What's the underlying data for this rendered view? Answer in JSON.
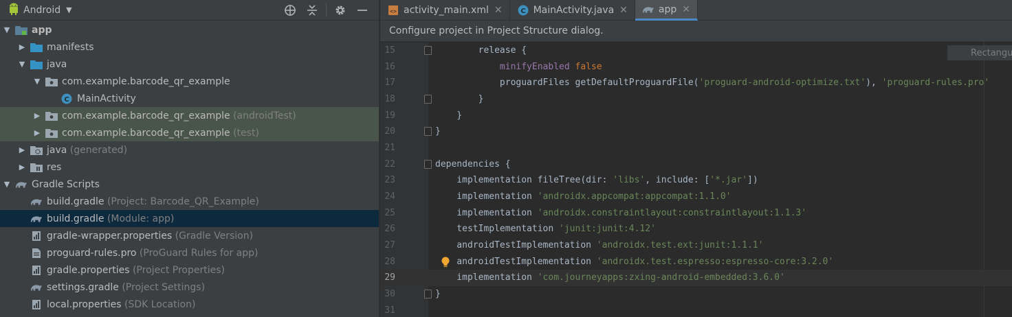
{
  "project_panel": {
    "view_name": "Android",
    "tree": [
      {
        "label": "app",
        "suffix": "",
        "bold": true,
        "depth": 0,
        "arrow": "down",
        "icon": "module-folder-icon",
        "style": ""
      },
      {
        "label": "manifests",
        "suffix": "",
        "bold": false,
        "depth": 1,
        "arrow": "right",
        "icon": "folder-icon",
        "style": ""
      },
      {
        "label": "java",
        "suffix": "",
        "bold": false,
        "depth": 1,
        "arrow": "down",
        "icon": "folder-icon",
        "style": ""
      },
      {
        "label": "com.example.barcode_qr_example",
        "suffix": "",
        "bold": false,
        "depth": 2,
        "arrow": "down",
        "icon": "package-icon",
        "style": ""
      },
      {
        "label": "MainActivity",
        "suffix": "",
        "bold": false,
        "depth": 3,
        "arrow": "",
        "icon": "class-icon",
        "style": ""
      },
      {
        "label": "com.example.barcode_qr_example",
        "suffix": " (androidTest)",
        "bold": false,
        "depth": 2,
        "arrow": "right",
        "icon": "package-icon",
        "style": "test"
      },
      {
        "label": "com.example.barcode_qr_example",
        "suffix": " (test)",
        "bold": false,
        "depth": 2,
        "arrow": "right",
        "icon": "package-icon",
        "style": "test"
      },
      {
        "label": "java",
        "suffix": " (generated)",
        "bold": false,
        "depth": 1,
        "arrow": "right",
        "icon": "generated-folder-icon",
        "style": ""
      },
      {
        "label": "res",
        "suffix": "",
        "bold": false,
        "depth": 1,
        "arrow": "right",
        "icon": "resources-folder-icon",
        "style": ""
      },
      {
        "label": "Gradle Scripts",
        "suffix": "",
        "bold": false,
        "depth": 0,
        "arrow": "down",
        "icon": "gradle-icon",
        "style": ""
      },
      {
        "label": "build.gradle",
        "suffix": " (Project: Barcode_QR_Example)",
        "bold": false,
        "depth": 1,
        "arrow": "",
        "icon": "gradle-icon",
        "style": ""
      },
      {
        "label": "build.gradle",
        "suffix": " (Module: app)",
        "bold": false,
        "depth": 1,
        "arrow": "",
        "icon": "gradle-icon",
        "style": "selected"
      },
      {
        "label": "gradle-wrapper.properties",
        "suffix": " (Gradle Version)",
        "bold": false,
        "depth": 1,
        "arrow": "",
        "icon": "properties-icon",
        "style": ""
      },
      {
        "label": "proguard-rules.pro",
        "suffix": " (ProGuard Rules for app)",
        "bold": false,
        "depth": 1,
        "arrow": "",
        "icon": "text-file-icon",
        "style": ""
      },
      {
        "label": "gradle.properties",
        "suffix": " (Project Properties)",
        "bold": false,
        "depth": 1,
        "arrow": "",
        "icon": "properties-icon",
        "style": ""
      },
      {
        "label": "settings.gradle",
        "suffix": " (Project Settings)",
        "bold": false,
        "depth": 1,
        "arrow": "",
        "icon": "gradle-icon",
        "style": ""
      },
      {
        "label": "local.properties",
        "suffix": " (SDK Location)",
        "bold": false,
        "depth": 1,
        "arrow": "",
        "icon": "properties-icon",
        "style": ""
      }
    ]
  },
  "editor": {
    "tabs": [
      {
        "label": "activity_main.xml",
        "icon": "xml-layout-icon",
        "active": false
      },
      {
        "label": "MainActivity.java",
        "icon": "class-icon",
        "active": false
      },
      {
        "label": "app",
        "icon": "gradle-icon",
        "active": true
      }
    ],
    "notice": "Configure project in Project Structure dialog.",
    "popup": "Rectangu",
    "current_line": 29,
    "lines": [
      {
        "n": "15",
        "fold": true,
        "bulb": false,
        "tokens": [
          [
            "        release {",
            "p"
          ]
        ]
      },
      {
        "n": "16",
        "fold": false,
        "bulb": false,
        "tokens": [
          [
            "            ",
            "p"
          ],
          [
            "minifyEnabled",
            "prop"
          ],
          [
            " ",
            "p"
          ],
          [
            "false",
            "kw"
          ]
        ]
      },
      {
        "n": "17",
        "fold": false,
        "bulb": false,
        "tokens": [
          [
            "            proguardFiles getDefaultProguardFile(",
            "p"
          ],
          [
            "'proguard-android-optimize.txt'",
            "str"
          ],
          [
            "), ",
            "p"
          ],
          [
            "'proguard-rules.pro'",
            "str"
          ]
        ]
      },
      {
        "n": "18",
        "fold": true,
        "bulb": false,
        "tokens": [
          [
            "        }",
            "p"
          ]
        ]
      },
      {
        "n": "19",
        "fold": false,
        "bulb": false,
        "tokens": [
          [
            "    }",
            "p"
          ]
        ]
      },
      {
        "n": "20",
        "fold": true,
        "bulb": false,
        "tokens": [
          [
            "}",
            "p"
          ]
        ]
      },
      {
        "n": "21",
        "fold": false,
        "bulb": false,
        "tokens": [
          [
            "",
            "p"
          ]
        ]
      },
      {
        "n": "22",
        "fold": true,
        "bulb": false,
        "tokens": [
          [
            "dependencies {",
            "p"
          ]
        ]
      },
      {
        "n": "23",
        "fold": false,
        "bulb": false,
        "tokens": [
          [
            "    implementation fileTree(",
            "p"
          ],
          [
            "dir",
            "named"
          ],
          [
            ": ",
            "p"
          ],
          [
            "'libs'",
            "str"
          ],
          [
            ", ",
            "p"
          ],
          [
            "include",
            "named"
          ],
          [
            ": [",
            "p"
          ],
          [
            "'*.jar'",
            "str"
          ],
          [
            "])",
            "p"
          ]
        ]
      },
      {
        "n": "24",
        "fold": false,
        "bulb": false,
        "tokens": [
          [
            "    implementation ",
            "p"
          ],
          [
            "'androidx.appcompat:appcompat:1.1.0'",
            "str"
          ]
        ]
      },
      {
        "n": "25",
        "fold": false,
        "bulb": false,
        "tokens": [
          [
            "    implementation ",
            "p"
          ],
          [
            "'androidx.constraintlayout:constraintlayout:1.1.3'",
            "str"
          ]
        ]
      },
      {
        "n": "26",
        "fold": false,
        "bulb": false,
        "tokens": [
          [
            "    testImplementation ",
            "p"
          ],
          [
            "'junit:junit:4.12'",
            "str"
          ]
        ]
      },
      {
        "n": "27",
        "fold": false,
        "bulb": false,
        "tokens": [
          [
            "    androidTestImplementation ",
            "p"
          ],
          [
            "'androidx.test.ext:junit:1.1.1'",
            "str"
          ]
        ]
      },
      {
        "n": "28",
        "fold": false,
        "bulb": true,
        "tokens": [
          [
            "    androidTestImplementation ",
            "p"
          ],
          [
            "'androidx.test.espresso:espresso-core:3.2.0'",
            "str"
          ]
        ]
      },
      {
        "n": "29",
        "fold": false,
        "bulb": false,
        "tokens": [
          [
            "    implementation ",
            "p"
          ],
          [
            "'com.journeyapps:zxing-android-embedded:3.6.0'",
            "str"
          ]
        ]
      },
      {
        "n": "30",
        "fold": true,
        "bulb": false,
        "tokens": [
          [
            "}",
            "p"
          ]
        ]
      },
      {
        "n": "31",
        "fold": false,
        "bulb": false,
        "tokens": [
          [
            "",
            "p"
          ]
        ]
      }
    ]
  },
  "colors": {
    "keyword": "#cc7832",
    "string": "#6a8759",
    "property": "#9876aa",
    "selection": "#0d293e",
    "test_row": "#49544a",
    "accent": "#4a88c7"
  }
}
